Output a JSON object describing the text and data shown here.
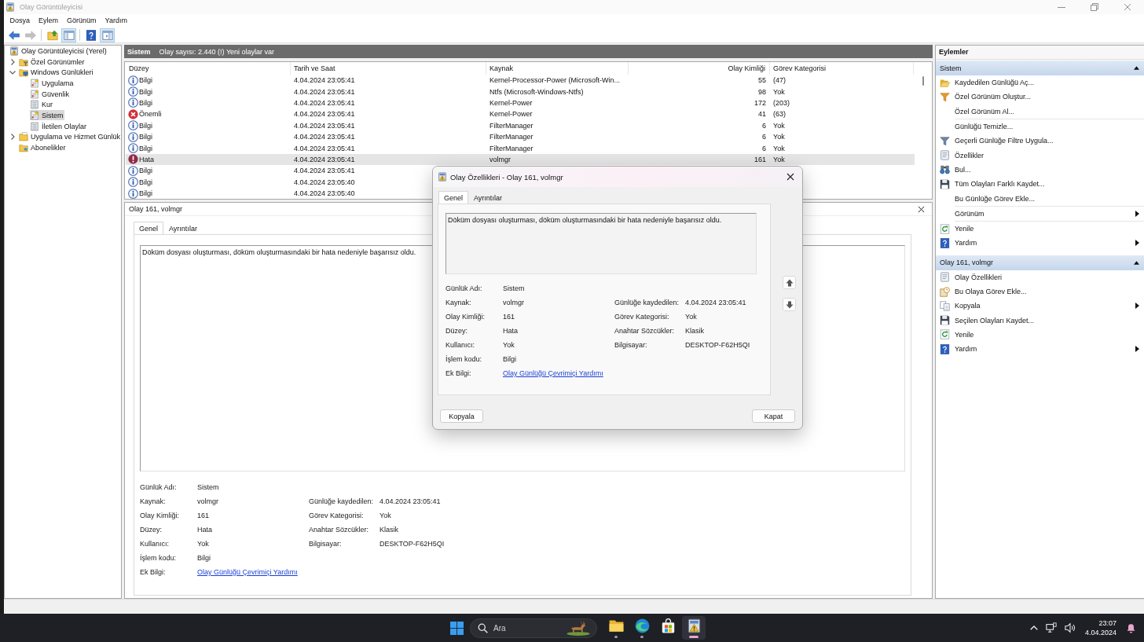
{
  "window": {
    "title": "Olay Görüntüleyicisi",
    "active": false
  },
  "menu": [
    "Dosya",
    "Eylem",
    "Görünüm",
    "Yardım"
  ],
  "toolbar": [
    {
      "disabled": false,
      "pressed": false
    },
    {
      "disabled": true,
      "pressed": false
    },
    {
      "disabled": false,
      "pressed": false
    },
    {
      "disabled": false,
      "pressed": true
    },
    {
      "disabled": false,
      "pressed": false
    },
    {
      "disabled": false,
      "pressed": true
    }
  ],
  "tree": [
    {
      "label": "Olay Görüntüleyicisi (Yerel)",
      "selected": false,
      "children": [
        {
          "label": "Özel Görünümler",
          "expanded": false,
          "selected": false
        },
        {
          "label": "Windows Günlükleri",
          "expanded": true,
          "selected": false,
          "children": [
            {
              "label": "Uygulama",
              "selected": false
            },
            {
              "label": "Güvenlik",
              "selected": false
            },
            {
              "label": "Kur",
              "selected": false
            },
            {
              "label": "Sistem",
              "selected": true
            },
            {
              "label": "İletilen Olaylar",
              "selected": false
            }
          ]
        },
        {
          "label": "Uygulama ve Hizmet Günlük",
          "expanded": false,
          "selected": false
        },
        {
          "label": "Abonelikler",
          "selected": false
        }
      ]
    }
  ],
  "log_header": {
    "title": "Sistem",
    "summary": "Olay sayısı: 2.440 (!) Yeni olaylar var"
  },
  "table": {
    "columns": [
      "Düzey",
      "Tarih ve Saat",
      "Kaynak",
      "Olay Kimliği",
      "Görev Kategorisi"
    ],
    "rows": [
      {
        "kind": "info",
        "severity": "Bilgi",
        "date": "4.04.2024 23:05:41",
        "source": "Kernel-Processor-Power (Microsoft-Win...",
        "event_id": "55",
        "task_category": "(47)",
        "selected": false
      },
      {
        "kind": "info",
        "severity": "Bilgi",
        "date": "4.04.2024 23:05:41",
        "source": "Ntfs (Microsoft-Windows-Ntfs)",
        "event_id": "98",
        "task_category": "Yok",
        "selected": false
      },
      {
        "kind": "info",
        "severity": "Bilgi",
        "date": "4.04.2024 23:05:41",
        "source": "Kernel-Power",
        "event_id": "172",
        "task_category": "(203)",
        "selected": false
      },
      {
        "kind": "critical",
        "severity": "Önemli",
        "date": "4.04.2024 23:05:41",
        "source": "Kernel-Power",
        "event_id": "41",
        "task_category": "(63)",
        "selected": false
      },
      {
        "kind": "info",
        "severity": "Bilgi",
        "date": "4.04.2024 23:05:41",
        "source": "FilterManager",
        "event_id": "6",
        "task_category": "Yok",
        "selected": false
      },
      {
        "kind": "info",
        "severity": "Bilgi",
        "date": "4.04.2024 23:05:41",
        "source": "FilterManager",
        "event_id": "6",
        "task_category": "Yok",
        "selected": false
      },
      {
        "kind": "info",
        "severity": "Bilgi",
        "date": "4.04.2024 23:05:41",
        "source": "FilterManager",
        "event_id": "6",
        "task_category": "Yok",
        "selected": false
      },
      {
        "kind": "error",
        "severity": "Hata",
        "date": "4.04.2024 23:05:41",
        "source": "volmgr",
        "event_id": "161",
        "task_category": "Yok",
        "selected": true
      },
      {
        "kind": "info",
        "severity": "Bilgi",
        "date": "4.04.2024 23:05:41",
        "selected": false
      },
      {
        "kind": "info",
        "severity": "Bilgi",
        "date": "4.04.2024 23:05:40",
        "selected": false
      },
      {
        "kind": "info",
        "severity": "Bilgi",
        "date": "4.04.2024 23:05:40",
        "selected": false
      }
    ]
  },
  "preview": {
    "title": "Olay 161, volmgr",
    "tabs": [
      {
        "label": "Genel",
        "selected": true
      },
      {
        "label": "Ayrıntılar",
        "selected": false
      }
    ],
    "message": "Döküm dosyası oluşturması, döküm oluşturmasındaki bir hata nedeniyle başarısız oldu.",
    "left_fields": [
      {
        "label": "Günlük Adı:",
        "value": "Sistem",
        "kind": "text"
      },
      {
        "label": "Kaynak:",
        "value": "volmgr",
        "kind": "text"
      },
      {
        "label": "Olay Kimliği:",
        "value": "161",
        "kind": "text"
      },
      {
        "label": "Düzey:",
        "value": "Hata",
        "kind": "text"
      },
      {
        "label": "Kullanıcı:",
        "value": "Yok",
        "kind": "text"
      },
      {
        "label": "İşlem kodu:",
        "value": "Bilgi",
        "kind": "text"
      },
      {
        "label": "Ek Bilgi:",
        "value": "Olay Günlüğü Çevrimiçi Yardımı",
        "kind": "link"
      }
    ],
    "right_fields": [
      {
        "label": "Günlüğe kaydedilen:",
        "value": "4.04.2024 23:05:41"
      },
      {
        "label": "Görev Kategorisi:",
        "value": "Yok"
      },
      {
        "label": "Anahtar Sözcükler:",
        "value": "Klasik"
      },
      {
        "label": "Bilgisayar:",
        "value": "DESKTOP-F62H5QI"
      }
    ]
  },
  "actions": {
    "title": "Eylemler",
    "sections": [
      {
        "title": "Sistem",
        "expanded": true,
        "items": [
          {
            "label": "Kaydedilen Günlüğü Aç...",
            "submenu": false
          },
          {
            "label": "Özel Görünüm Oluştur...",
            "submenu": false
          },
          {
            "label": "Özel Görünüm Al...",
            "submenu": false
          },
          {
            "label": "Günlüğü Temizle...",
            "submenu": false
          },
          {
            "label": "Geçerli Günlüğe Filtre Uygula...",
            "submenu": false
          },
          {
            "label": "Özellikler",
            "submenu": false
          },
          {
            "label": "Bul...",
            "submenu": false
          },
          {
            "label": "Tüm Olayları Farklı Kaydet...",
            "submenu": false
          },
          {
            "label": "Bu Günlüğe Görev Ekle...",
            "submenu": false
          },
          {
            "label": "Görünüm",
            "submenu": true
          },
          {
            "label": "Yenile",
            "submenu": false
          },
          {
            "label": "Yardım",
            "submenu": true
          }
        ]
      },
      {
        "title": "Olay 161, volmgr",
        "expanded": true,
        "items": [
          {
            "label": "Olay Özellikleri",
            "submenu": false
          },
          {
            "label": "Bu Olaya Görev Ekle...",
            "submenu": false
          },
          {
            "label": "Kopyala",
            "submenu": true
          },
          {
            "label": "Seçilen Olayları Kaydet...",
            "submenu": false
          },
          {
            "label": "Yenile",
            "submenu": false
          },
          {
            "label": "Yardım",
            "submenu": true
          }
        ]
      }
    ]
  },
  "dialog": {
    "title": "Olay Özellikleri - Olay 161, volmgr",
    "tabs": [
      {
        "label": "Genel",
        "selected": true
      },
      {
        "label": "Ayrıntılar",
        "selected": false
      }
    ],
    "message": "Döküm dosyası oluşturması, döküm oluşturmasındaki bir hata nedeniyle başarısız oldu.",
    "left_fields": [
      {
        "label": "Günlük Adı:",
        "value": "Sistem",
        "kind": "text"
      },
      {
        "label": "Kaynak:",
        "value": "volmgr",
        "kind": "text"
      },
      {
        "label": "Olay Kimliği:",
        "value": "161",
        "kind": "text"
      },
      {
        "label": "Düzey:",
        "value": "Hata",
        "kind": "text"
      },
      {
        "label": "Kullanıcı:",
        "value": "Yok",
        "kind": "text"
      },
      {
        "label": "İşlem kodu:",
        "value": "Bilgi",
        "kind": "text"
      },
      {
        "label": "Ek Bilgi:",
        "value": "Olay Günlüğü Çevrimiçi Yardımı",
        "kind": "link"
      }
    ],
    "right_fields": [
      {
        "label": "Günlüğe kaydedilen:",
        "value": "4.04.2024 23:05:41"
      },
      {
        "label": "Görev Kategorisi:",
        "value": "Yok"
      },
      {
        "label": "Anahtar Sözcükler:",
        "value": "Klasik"
      },
      {
        "label": "Bilgisayar:",
        "value": "DESKTOP-F62H5QI"
      }
    ],
    "buttons": [
      "Kopyala",
      "Kapat"
    ]
  },
  "taskbar": {
    "search": {
      "placeholder": "Ara"
    },
    "apps": [
      {
        "running": true,
        "active": false
      },
      {
        "running": true,
        "active": false
      },
      {
        "running": false,
        "active": false
      },
      {
        "running": true,
        "active": true
      }
    ],
    "clock": {
      "time": "23:07",
      "date": "4.04.2024"
    }
  }
}
